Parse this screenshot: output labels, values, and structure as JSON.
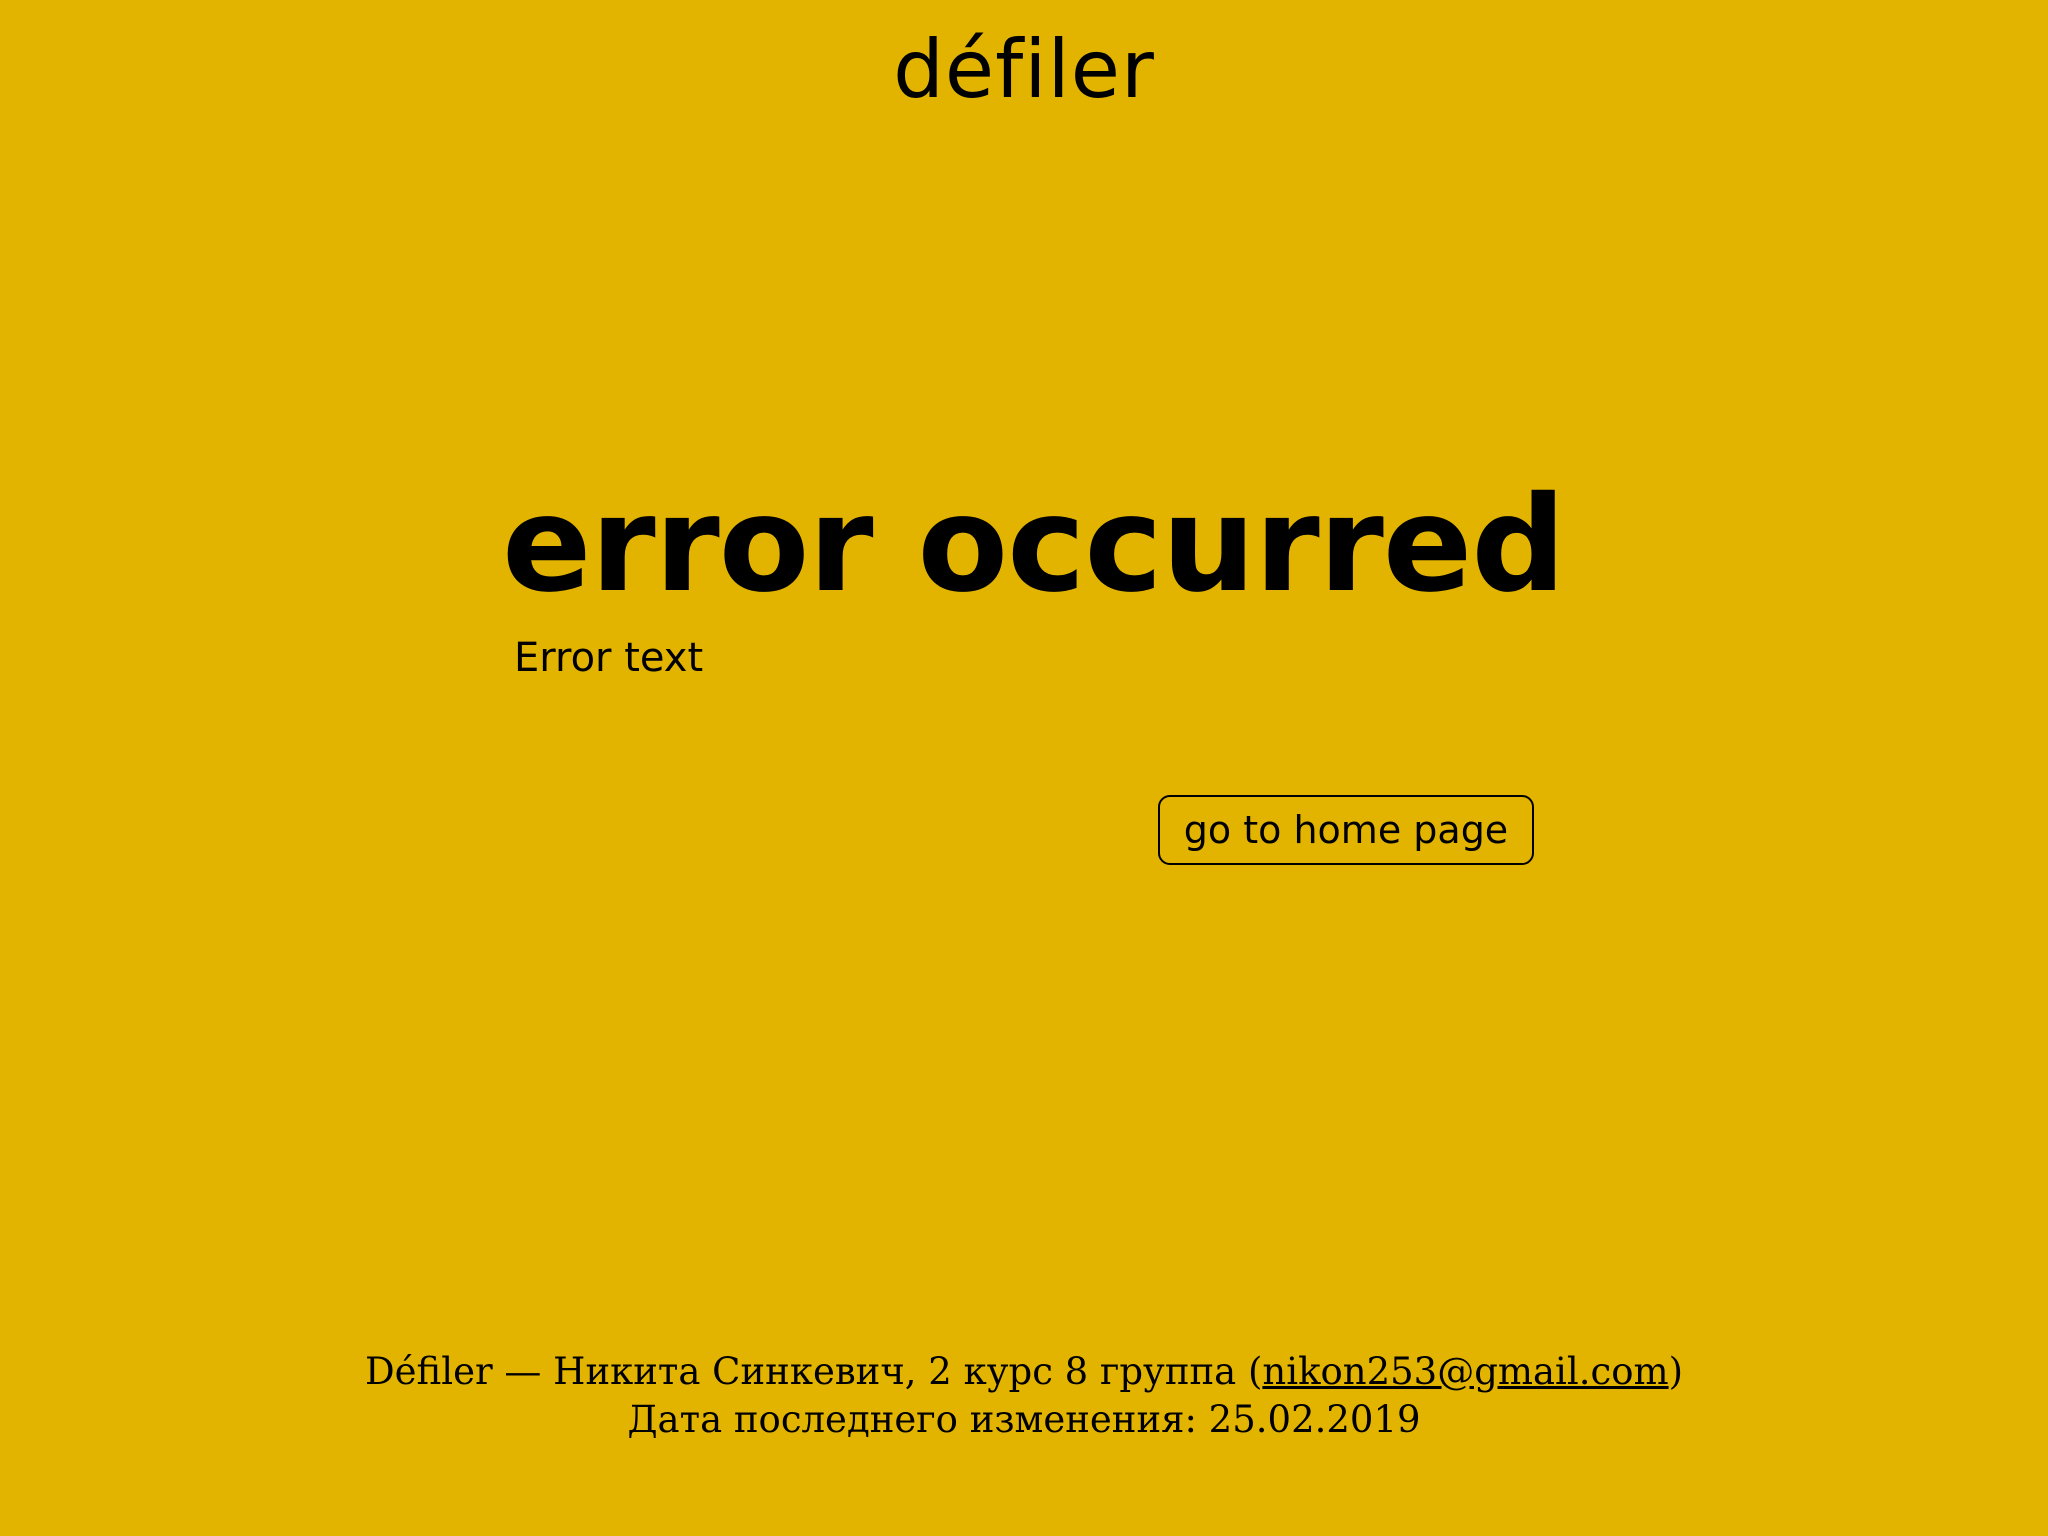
{
  "header": {
    "logo_text": "défiler"
  },
  "main": {
    "title": "error occurred",
    "message": "Error text",
    "home_button_label": "go to home page"
  },
  "footer": {
    "line1_prefix": "Défiler — Никита Синкевич, 2 курс 8 группа (",
    "email": "nikon253@gmail.com",
    "line1_suffix": ")",
    "line2": "Дата последнего изменения: 25.02.2019"
  },
  "colors": {
    "background": "#e2b400",
    "text": "#000000"
  }
}
